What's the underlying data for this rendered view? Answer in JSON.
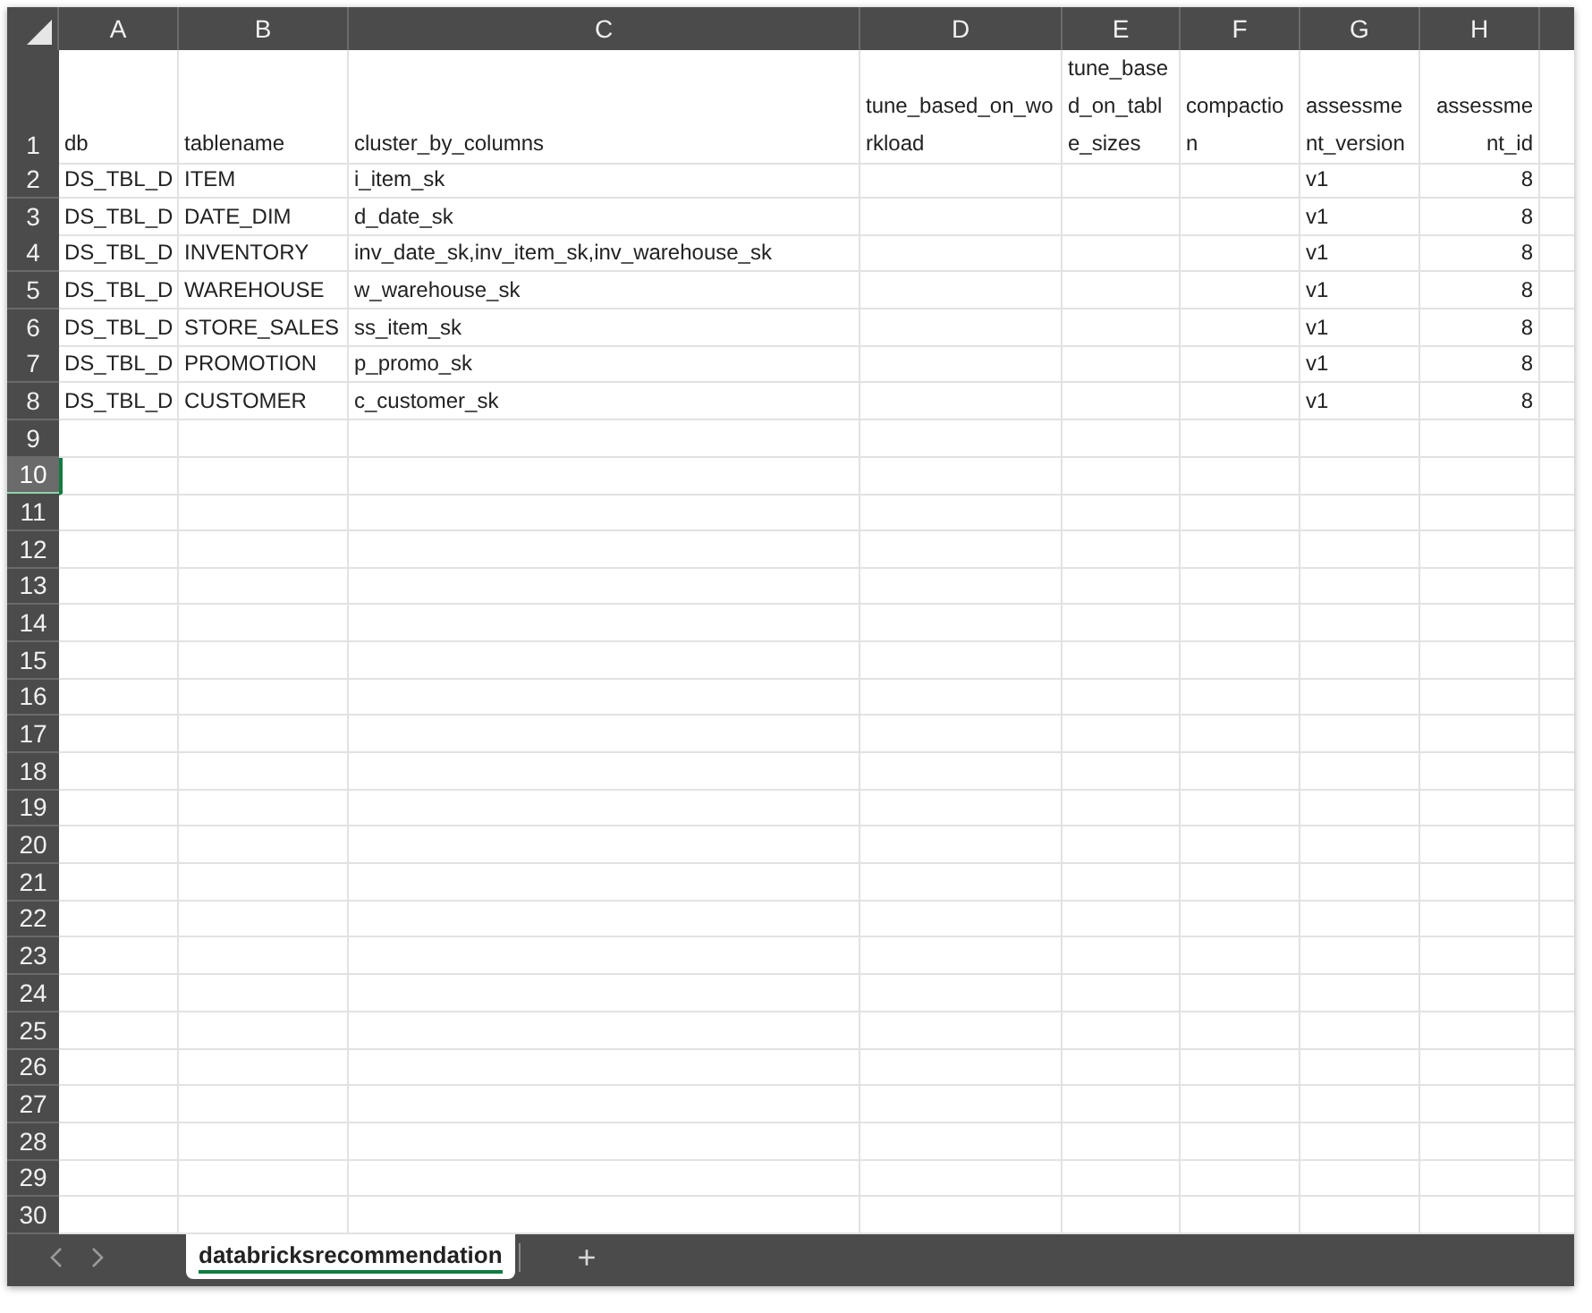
{
  "columns": [
    {
      "label": "A"
    },
    {
      "label": "B"
    },
    {
      "label": "C"
    },
    {
      "label": "D"
    },
    {
      "label": "E"
    },
    {
      "label": "F"
    },
    {
      "label": "G"
    },
    {
      "label": "H"
    }
  ],
  "rows": [
    {
      "number": "1",
      "selected": false,
      "kind": "header",
      "cells": [
        "db",
        "tablename",
        "cluster_by_columns",
        "tune_based_on_workload",
        "tune_based_on_table_sizes",
        "compaction",
        "assessment_version",
        "assessment_id"
      ]
    },
    {
      "number": "2",
      "selected": false,
      "kind": "data",
      "cells": [
        "DS_TBL_D",
        "ITEM",
        "i_item_sk",
        "",
        "",
        "",
        "v1",
        "8"
      ]
    },
    {
      "number": "3",
      "selected": false,
      "kind": "data",
      "cells": [
        "DS_TBL_D",
        "DATE_DIM",
        "d_date_sk",
        "",
        "",
        "",
        "v1",
        "8"
      ]
    },
    {
      "number": "4",
      "selected": false,
      "kind": "data",
      "cells": [
        "DS_TBL_D",
        "INVENTORY",
        "inv_date_sk,inv_item_sk,inv_warehouse_sk",
        "",
        "",
        "",
        "v1",
        "8"
      ]
    },
    {
      "number": "5",
      "selected": false,
      "kind": "data",
      "cells": [
        "DS_TBL_D",
        "WAREHOUSE",
        "w_warehouse_sk",
        "",
        "",
        "",
        "v1",
        "8"
      ]
    },
    {
      "number": "6",
      "selected": false,
      "kind": "data",
      "cells": [
        "DS_TBL_D",
        "STORE_SALES",
        "ss_item_sk",
        "",
        "",
        "",
        "v1",
        "8"
      ]
    },
    {
      "number": "7",
      "selected": false,
      "kind": "data",
      "cells": [
        "DS_TBL_D",
        "PROMOTION",
        "p_promo_sk",
        "",
        "",
        "",
        "v1",
        "8"
      ]
    },
    {
      "number": "8",
      "selected": false,
      "kind": "data",
      "cells": [
        "DS_TBL_D",
        "CUSTOMER",
        "c_customer_sk",
        "",
        "",
        "",
        "v1",
        "8"
      ]
    },
    {
      "number": "9",
      "selected": false,
      "kind": "empty"
    },
    {
      "number": "10",
      "selected": true,
      "kind": "empty"
    },
    {
      "number": "11",
      "selected": false,
      "kind": "empty"
    },
    {
      "number": "12",
      "selected": false,
      "kind": "empty"
    },
    {
      "number": "13",
      "selected": false,
      "kind": "empty"
    },
    {
      "number": "14",
      "selected": false,
      "kind": "empty"
    },
    {
      "number": "15",
      "selected": false,
      "kind": "empty"
    },
    {
      "number": "16",
      "selected": false,
      "kind": "empty"
    },
    {
      "number": "17",
      "selected": false,
      "kind": "empty"
    },
    {
      "number": "18",
      "selected": false,
      "kind": "empty"
    },
    {
      "number": "19",
      "selected": false,
      "kind": "empty"
    },
    {
      "number": "20",
      "selected": false,
      "kind": "empty"
    },
    {
      "number": "21",
      "selected": false,
      "kind": "empty"
    },
    {
      "number": "22",
      "selected": false,
      "kind": "empty"
    },
    {
      "number": "23",
      "selected": false,
      "kind": "empty"
    },
    {
      "number": "24",
      "selected": false,
      "kind": "empty"
    },
    {
      "number": "25",
      "selected": false,
      "kind": "empty"
    },
    {
      "number": "26",
      "selected": false,
      "kind": "empty"
    },
    {
      "number": "27",
      "selected": false,
      "kind": "empty"
    },
    {
      "number": "28",
      "selected": false,
      "kind": "empty"
    },
    {
      "number": "29",
      "selected": false,
      "kind": "empty"
    },
    {
      "number": "30",
      "selected": false,
      "kind": "empty"
    }
  ],
  "sheet_tabs": [
    {
      "label": "databricksrecommendation",
      "selected": true
    }
  ],
  "add_sheet": "+"
}
